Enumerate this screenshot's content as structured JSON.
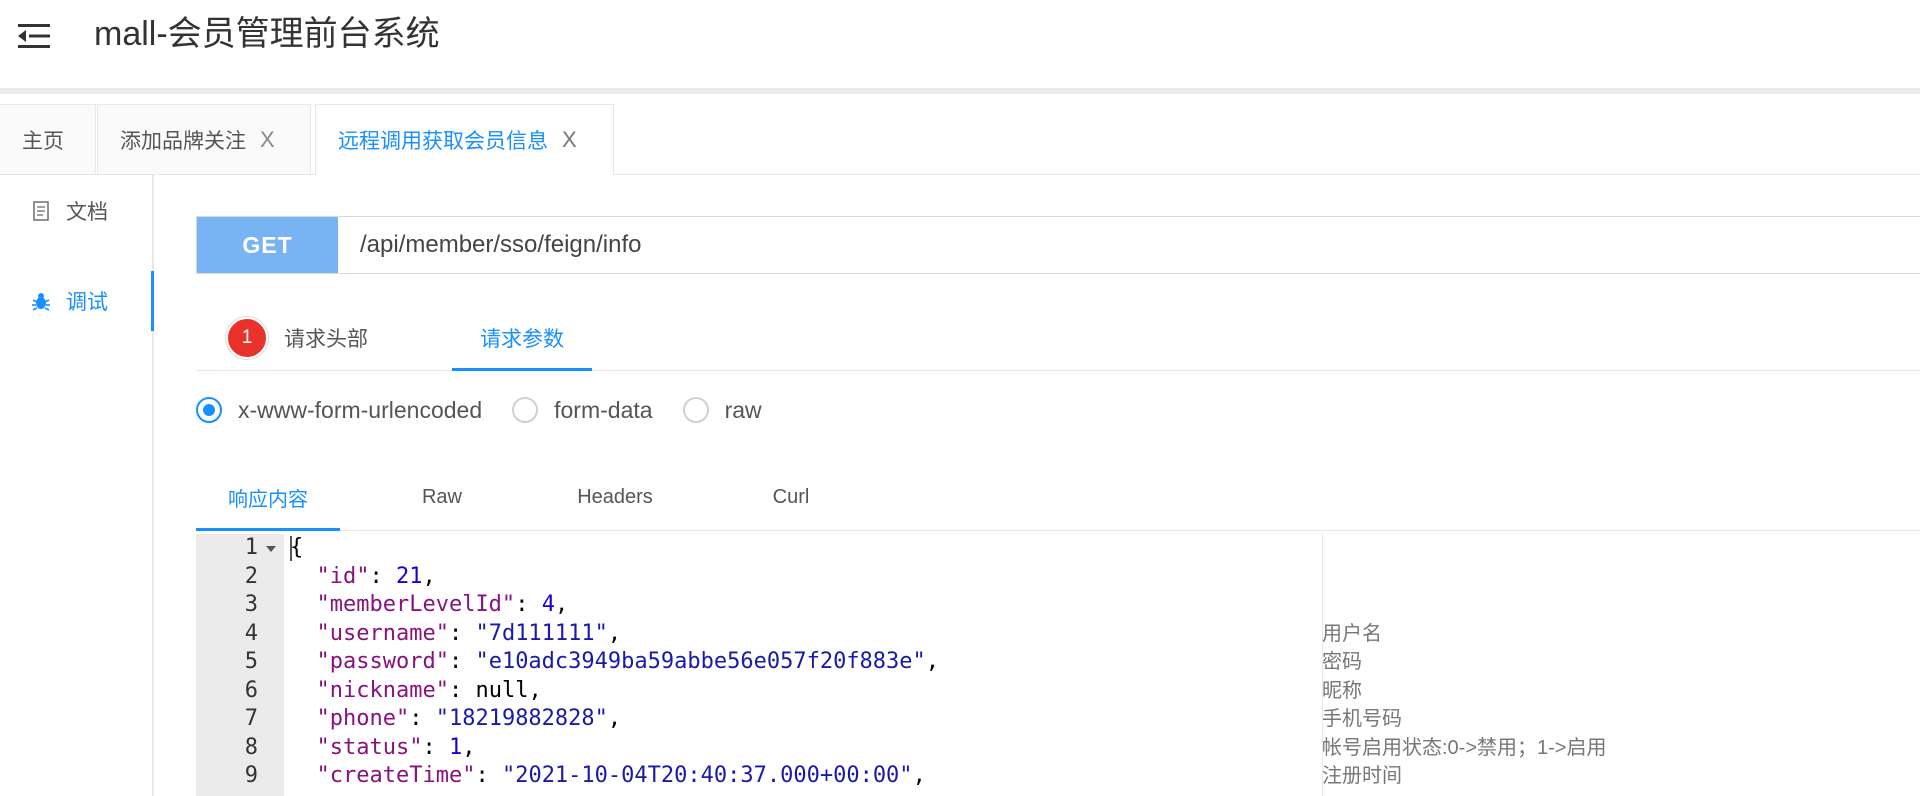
{
  "app": {
    "title": "mall-会员管理前台系统"
  },
  "tabs": [
    {
      "label": "主页",
      "closable": false
    },
    {
      "label": "添加品牌关注",
      "closable": true
    },
    {
      "label": "远程调用获取会员信息",
      "closable": true,
      "active": true
    }
  ],
  "tab_close_glyph": "X",
  "sidebar": {
    "items": [
      {
        "label": "文档",
        "icon": "document-icon"
      },
      {
        "label": "调试",
        "icon": "bug-icon",
        "active": true
      }
    ]
  },
  "request": {
    "method": "GET",
    "url": "/api/member/sso/feign/info"
  },
  "request_tabs": [
    {
      "label": "请求头部",
      "badge": "1"
    },
    {
      "label": "请求参数",
      "active": true
    }
  ],
  "body_types": [
    {
      "label": "x-www-form-urlencoded",
      "checked": true
    },
    {
      "label": "form-data",
      "checked": false
    },
    {
      "label": "raw",
      "checked": false
    }
  ],
  "response_tabs": [
    {
      "label": "响应内容",
      "active": true
    },
    {
      "label": "Raw"
    },
    {
      "label": "Headers"
    },
    {
      "label": "Curl"
    }
  ],
  "response": {
    "lines": [
      {
        "no": "1",
        "open": "{"
      },
      {
        "no": "2",
        "key": "\"id\"",
        "value": "21",
        "vtype": "n",
        "comment": ""
      },
      {
        "no": "3",
        "key": "\"memberLevelId\"",
        "value": "4",
        "vtype": "n",
        "comment": ""
      },
      {
        "no": "4",
        "key": "\"username\"",
        "value": "\"7d111111\"",
        "vtype": "s",
        "comment": "用户名"
      },
      {
        "no": "5",
        "key": "\"password\"",
        "value": "\"e10adc3949ba59abbe56e057f20f883e\"",
        "vtype": "s",
        "comment": "密码"
      },
      {
        "no": "6",
        "key": "\"nickname\"",
        "value": "null",
        "vtype": "p",
        "comment": "昵称"
      },
      {
        "no": "7",
        "key": "\"phone\"",
        "value": "\"18219882828\"",
        "vtype": "s",
        "comment": "手机号码"
      },
      {
        "no": "8",
        "key": "\"status\"",
        "value": "1",
        "vtype": "n",
        "comment": "帐号启用状态:0->禁用；1->启用"
      },
      {
        "no": "9",
        "key": "\"createTime\"",
        "value": "\"2021-10-04T20:40:37.000+00:00\"",
        "vtype": "s",
        "comment": "注册时间"
      }
    ]
  },
  "colors": {
    "accent": "#1890ff",
    "method_bg": "#78b4f4",
    "badge": "#e8322b"
  }
}
